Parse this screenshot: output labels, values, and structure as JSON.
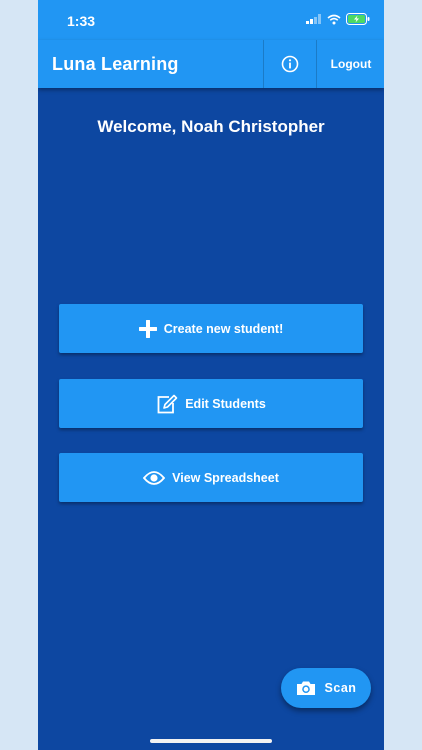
{
  "status_bar": {
    "time": "1:33"
  },
  "app_bar": {
    "title": "Luna Learning",
    "logout_label": "Logout",
    "info_icon": "info-icon"
  },
  "main": {
    "welcome": "Welcome, Noah Christopher",
    "buttons": [
      {
        "label": "Create new student!",
        "icon": "plus-icon"
      },
      {
        "label": "Edit Students",
        "icon": "edit-icon"
      },
      {
        "label": "View Spreadsheet",
        "icon": "eye-icon"
      }
    ]
  },
  "fab": {
    "label": "Scan",
    "icon": "camera-icon"
  },
  "colors": {
    "primary": "#2196f3",
    "background": "#0d47a1",
    "text": "#ffffff"
  }
}
